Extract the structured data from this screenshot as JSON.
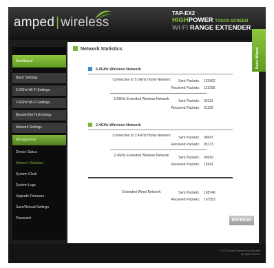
{
  "brand": {
    "logo_left": "amped",
    "logo_right": "wireless",
    "model": "TAP-EX2",
    "line2_a": "HIGH",
    "line2_b": "POWER",
    "line2_small": "TOUCH SCREEN",
    "line3_a": "WI-FI",
    "line3_b": "RANGE EXTENDER"
  },
  "side_tab": "Basic Wizard",
  "sidebar": {
    "dashboard": "Dashboard",
    "items": [
      "Basic Settings",
      "5.0GHz Wi-Fi Settings",
      "2.4GHz Wi-Fi Settings",
      "BoosterNet Technology",
      "Network Settings",
      "Management",
      "Device Status",
      "Network Statistics",
      "System Clock",
      "System Logs",
      "Upgrade Firmware",
      "Save/Reload Settings",
      "Password"
    ]
  },
  "page": {
    "title": "Network Statistics"
  },
  "sections": {
    "ghz5": {
      "title": "5.0GHz Wireless Network",
      "home_label": "Connection to 5.0GHz Home Network:",
      "home_sent": "123962",
      "home_recv": "121095",
      "ext_label": "5.0GHz Extended Wireless Network:",
      "ext_sent": "30112",
      "ext_recv": "31225"
    },
    "ghz24": {
      "title": "2.4GHz Wireless Network",
      "home_label": "Connection to 2.4GHz Home Network:",
      "home_sent": "98547",
      "home_recv": "95173",
      "ext_label": "2.4GHz Extended Wireless Network:",
      "ext_sent": "68916",
      "ext_recv": "15941"
    },
    "wired": {
      "label": "Extended Wired Network:",
      "sent": "158746",
      "recv": "167553"
    }
  },
  "labels": {
    "sent": "Sent Packets:",
    "recv": "Received Packets:"
  },
  "refresh_label": "REFRESH",
  "copyright": [
    "© 2012 Amped Wireless Incorporated",
    "All rights reserved"
  ],
  "colors": {
    "accent": "#7fb43a",
    "blue_marker": "#3a8fd0"
  }
}
